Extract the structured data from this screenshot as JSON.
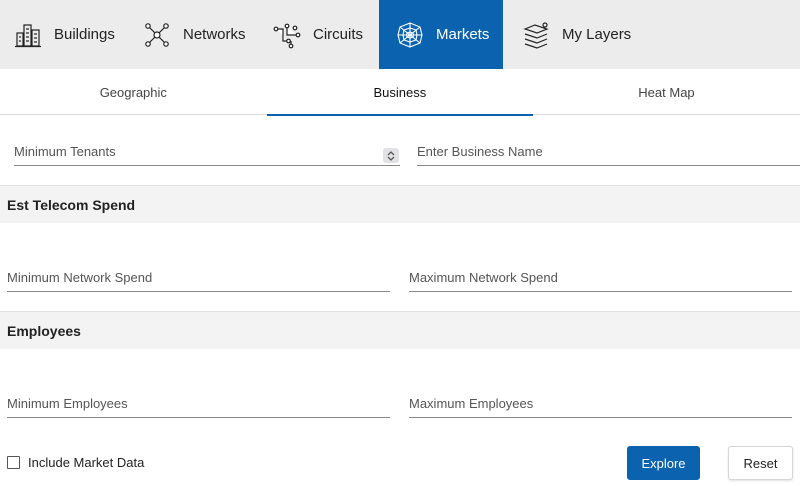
{
  "nav": {
    "buildings": {
      "label": "Buildings",
      "icon": "buildings-icon"
    },
    "networks": {
      "label": "Networks",
      "icon": "network-icon"
    },
    "circuits": {
      "label": "Circuits",
      "icon": "circuit-icon"
    },
    "markets": {
      "label": "Markets",
      "icon": "web-icon"
    },
    "layers": {
      "label": "My Layers",
      "icon": "layers-icon"
    },
    "active": "Markets"
  },
  "subtabs": {
    "geographic": "Geographic",
    "business": "Business",
    "heatmap": "Heat Map",
    "active": "Business"
  },
  "filters": {
    "min_tenants_placeholder": "Minimum Tenants",
    "business_name_placeholder": "Enter Business Name"
  },
  "telecom_spend": {
    "title": "Est Telecom Spend",
    "min_placeholder": "Minimum Network Spend",
    "max_placeholder": "Maximum Network Spend"
  },
  "employees": {
    "title": "Employees",
    "min_placeholder": "Minimum Employees",
    "max_placeholder": "Maximum Employees"
  },
  "footer": {
    "include_market_data_label": "Include Market Data",
    "explore_label": "Explore",
    "reset_label": "Reset"
  },
  "colors": {
    "accent": "#0b63b0",
    "nav_bg": "#ececec",
    "section_bg": "#f3f3f3"
  }
}
